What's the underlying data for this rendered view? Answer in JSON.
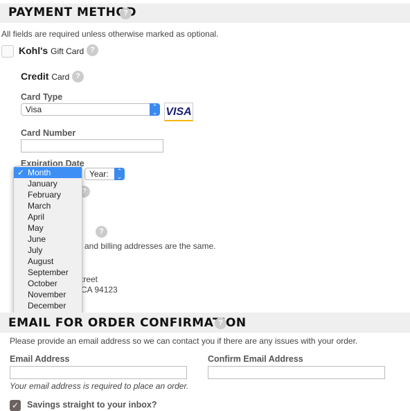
{
  "payment": {
    "title": "PAYMENT METHOD",
    "required_note": "All fields are required unless otherwise marked as optional.",
    "gift_card": {
      "bold": "Kohl's",
      "rest": "Gift Card",
      "checked": false
    },
    "credit": {
      "bold": "Credit",
      "rest": "Card"
    },
    "card_type": {
      "label": "Card Type",
      "value": "Visa",
      "logo": "VISA"
    },
    "card_number": {
      "label": "Card Number",
      "value": ""
    },
    "expiration": {
      "label": "Expiration Date",
      "month_options": [
        "Month",
        "January",
        "February",
        "March",
        "April",
        "May",
        "June",
        "July",
        "August",
        "September",
        "October",
        "November",
        "December"
      ],
      "selected": "Month",
      "year_value": "Year:"
    },
    "billing": {
      "heading_fragment": "ss",
      "same_fragment": "and billing addresses are the same.",
      "addr1_fragment": "treet",
      "addr2_fragment": "CA 94123"
    }
  },
  "email": {
    "title": "EMAIL FOR ORDER CONFIRMATION",
    "note": "Please provide an email address so we can contact you if there are any issues with your order.",
    "email_label": "Email Address",
    "confirm_label": "Confirm Email Address",
    "email_value": "",
    "confirm_value": "",
    "required_note": "Your email address is required to place an order.",
    "savings": {
      "label": "Savings straight to your inbox?",
      "checked": true
    }
  },
  "colors": {
    "accent": "#3d8ff5",
    "header_bg": "#efefef",
    "checkbox_checked": "#6b6360",
    "visa_blue": "#1a1f71",
    "visa_gold": "#f7b600"
  }
}
